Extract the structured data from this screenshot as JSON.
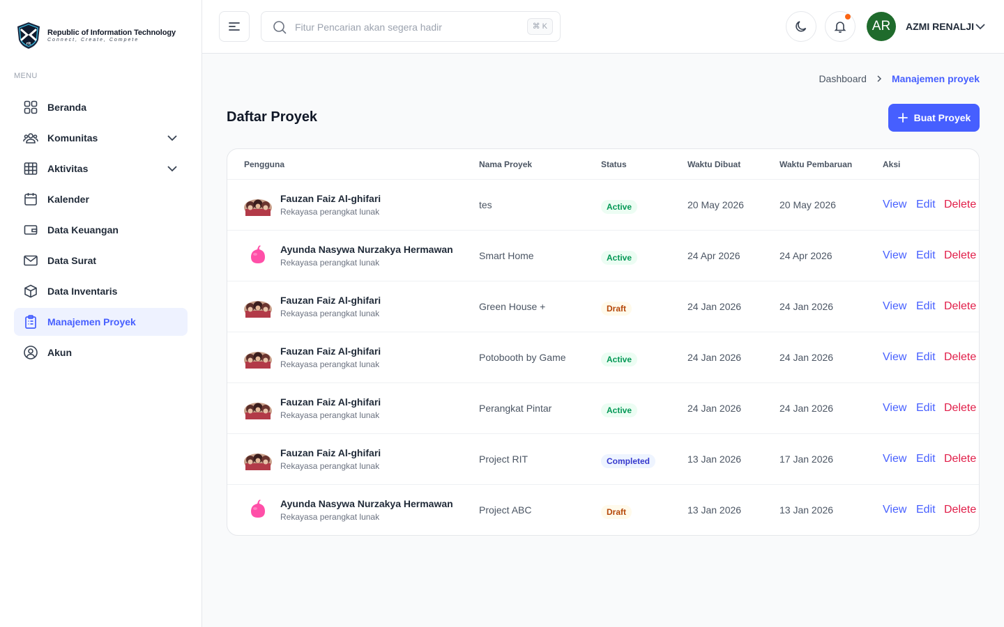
{
  "brand": {
    "name": "Republic of Information Technology",
    "tagline": "Connect, Create, Compete",
    "logo_icon": "rit-shield-logo"
  },
  "sidebar": {
    "menu_title": "MENU",
    "items": [
      {
        "label": "Beranda",
        "icon": "grid-icon"
      },
      {
        "label": "Komunitas",
        "icon": "users-icon"
      },
      {
        "label": "Aktivitas",
        "icon": "table-icon"
      },
      {
        "label": "Kalender",
        "icon": "calendar-icon"
      },
      {
        "label": "Data Keuangan",
        "icon": "wallet-icon"
      },
      {
        "label": "Data Surat",
        "icon": "mail-icon"
      },
      {
        "label": "Data Inventaris",
        "icon": "box-icon"
      },
      {
        "label": "Manajemen Proyek",
        "icon": "clipboard-icon"
      },
      {
        "label": "Akun",
        "icon": "user-circle-icon"
      }
    ],
    "active_index": 7
  },
  "header": {
    "search_placeholder": "Fitur Pencarian akan segera hadir",
    "search_shortcut": "⌘ K",
    "avatar_initials": "AR",
    "user_name": "AZMI RENALJI"
  },
  "breadcrumb": {
    "home": "Dashboard",
    "current": "Manajemen proyek"
  },
  "page": {
    "title": "Daftar Proyek",
    "create_button": "Buat Proyek"
  },
  "table": {
    "headers": {
      "user": "Pengguna",
      "project": "Nama Proyek",
      "status": "Status",
      "created": "Waktu Dibuat",
      "updated": "Waktu Pembaruan",
      "actions": "Aksi"
    },
    "action_labels": {
      "view": "View",
      "edit": "Edit",
      "delete": "Delete"
    },
    "rows": [
      {
        "user": "Fauzan Faiz Al-ghifari",
        "role": "Rekayasa perangkat lunak",
        "avatar": "photo",
        "project": "tes",
        "status": "Active",
        "status_kind": "active",
        "created": "20 May 2026",
        "updated": "20 May 2026"
      },
      {
        "user": "Ayunda Nasywa Nurzakya Hermawan",
        "role": "Rekayasa perangkat lunak",
        "avatar": "pink-blob",
        "project": "Smart Home",
        "status": "Active",
        "status_kind": "active",
        "created": "24 Apr 2026",
        "updated": "24 Apr 2026"
      },
      {
        "user": "Fauzan Faiz Al-ghifari",
        "role": "Rekayasa perangkat lunak",
        "avatar": "photo",
        "project": "Green House +",
        "status": "Draft",
        "status_kind": "draft",
        "created": "24 Jan 2026",
        "updated": "24 Jan 2026"
      },
      {
        "user": "Fauzan Faiz Al-ghifari",
        "role": "Rekayasa perangkat lunak",
        "avatar": "photo",
        "project": "Potobooth by Game",
        "status": "Active",
        "status_kind": "active",
        "created": "24 Jan 2026",
        "updated": "24 Jan 2026"
      },
      {
        "user": "Fauzan Faiz Al-ghifari",
        "role": "Rekayasa perangkat lunak",
        "avatar": "photo",
        "project": "Perangkat Pintar",
        "status": "Active",
        "status_kind": "active",
        "created": "24 Jan 2026",
        "updated": "24 Jan 2026"
      },
      {
        "user": "Fauzan Faiz Al-ghifari",
        "role": "Rekayasa perangkat lunak",
        "avatar": "photo",
        "project": "Project RIT",
        "status": "Completed",
        "status_kind": "completed",
        "created": "13 Jan 2026",
        "updated": "17 Jan 2026"
      },
      {
        "user": "Ayunda Nasywa Nurzakya Hermawan",
        "role": "Rekayasa perangkat lunak",
        "avatar": "pink-blob",
        "project": "Project ABC",
        "status": "Draft",
        "status_kind": "draft",
        "created": "13 Jan 2026",
        "updated": "13 Jan 2026"
      }
    ]
  },
  "colors": {
    "primary": "#465fff",
    "delete": "#e11d48",
    "notification_dot": "#fb6514",
    "avatar_bg": "#1f6b2c"
  }
}
